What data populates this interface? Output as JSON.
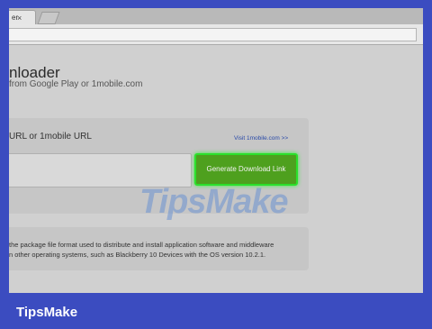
{
  "browser": {
    "tab_label": "er",
    "tab_close": "×"
  },
  "page": {
    "title": "nloader",
    "subtitle": "from Google Play or 1mobile.com",
    "input_label": "URL or 1mobile URL",
    "visit_link": "Visit 1mobile.com >>",
    "generate_button": "Generate Download Link",
    "description_line1": "the package file format used to distribute and install application software and middleware",
    "description_line2": "n other operating systems, such as Blackberry 10 Devices with the OS version 10.2.1."
  },
  "watermark": "TipsMake",
  "brand": "TipsMake",
  "colors": {
    "frame": "#3b4cc0",
    "button": "#4ea01e",
    "highlight": "#2be02b",
    "link": "#2a4aa8"
  }
}
